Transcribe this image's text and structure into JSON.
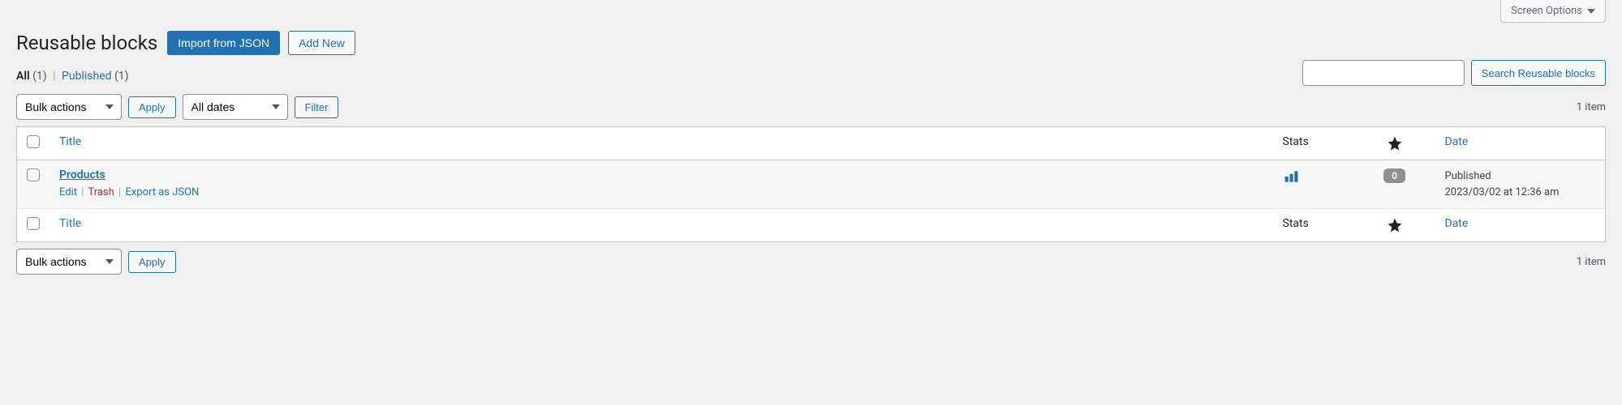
{
  "screen_options_label": "Screen Options",
  "page_title": "Reusable blocks",
  "buttons": {
    "import_json": "Import from JSON",
    "add_new": "Add New",
    "apply": "Apply",
    "filter": "Filter",
    "search": "Search Reusable blocks"
  },
  "filter_links": {
    "all_label": "All",
    "all_count": "(1)",
    "published_label": "Published",
    "published_count": "(1)"
  },
  "selects": {
    "bulk_actions": "Bulk actions",
    "all_dates": "All dates"
  },
  "item_count": "1 item",
  "columns": {
    "title": "Title",
    "stats": "Stats",
    "date": "Date"
  },
  "row": {
    "title": "Products",
    "actions": {
      "edit": "Edit",
      "trash": "Trash",
      "export": "Export as JSON"
    },
    "star_count": "0",
    "date_status": "Published",
    "date_value": "2023/03/02 at 12:36 am"
  }
}
